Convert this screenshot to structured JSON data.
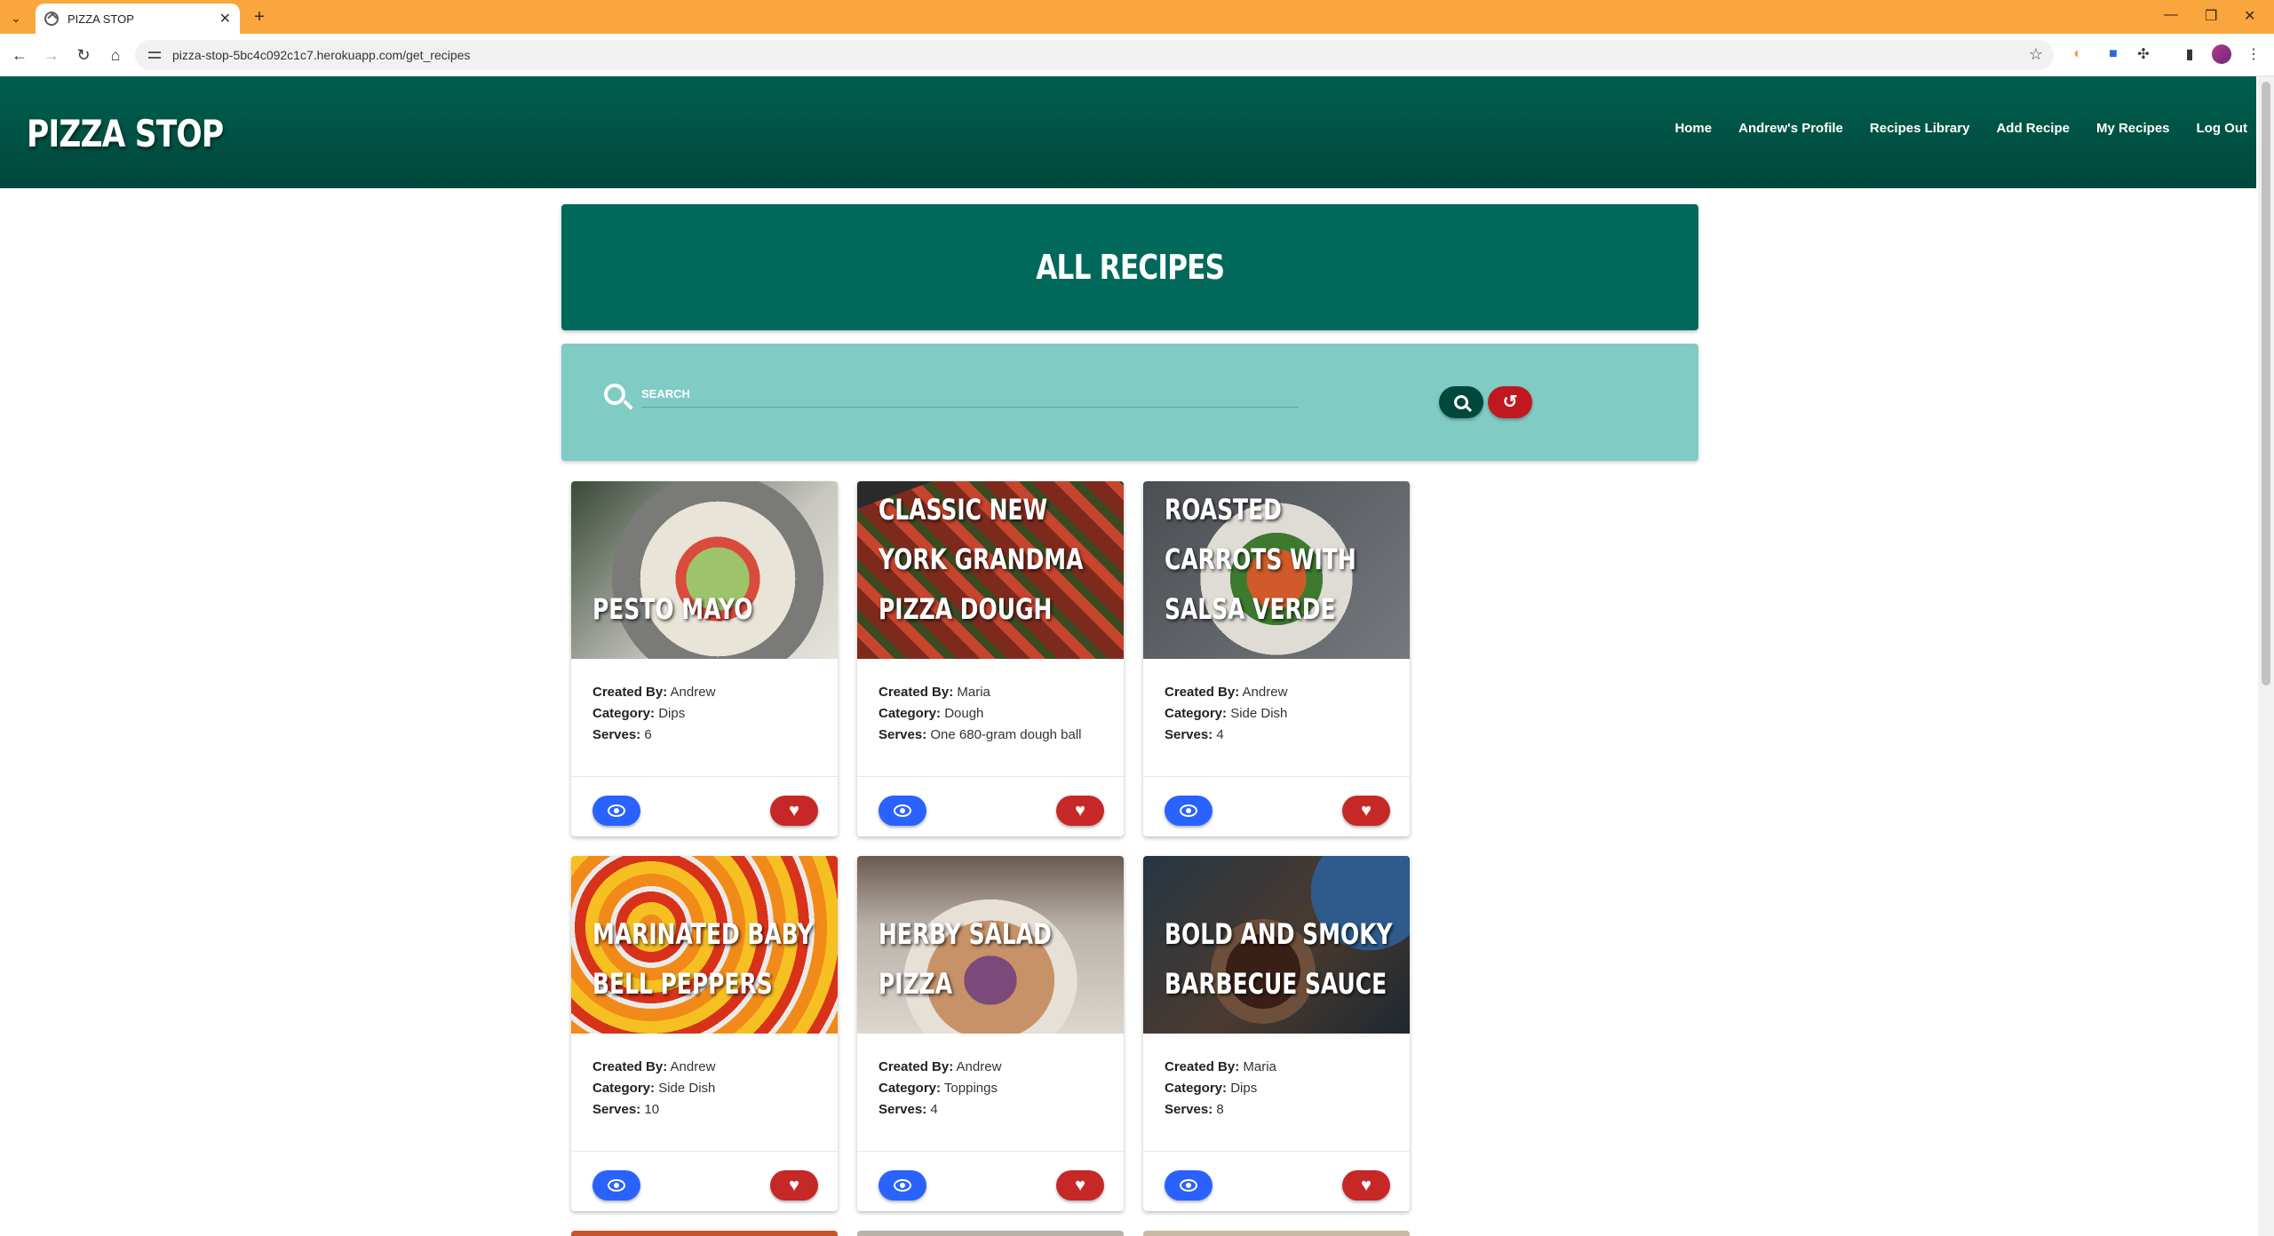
{
  "browser": {
    "tab_title": "PIZZA STOP",
    "url": "pizza-stop-5bc4c092c1c7.herokuapp.com/get_recipes"
  },
  "header": {
    "logo": "PIZZA STOP",
    "nav": [
      "Home",
      "Andrew's Profile",
      "Recipes Library",
      "Add Recipe",
      "My Recipes",
      "Log Out"
    ]
  },
  "page": {
    "title": "ALL RECIPES"
  },
  "search": {
    "placeholder": "SEARCH"
  },
  "labels": {
    "created_by": "Created By:",
    "category": "Category:",
    "serves": "Serves:"
  },
  "recipes": [
    {
      "title": "PESTO MAYO",
      "created_by": "Andrew",
      "category": "Dips",
      "serves": "6"
    },
    {
      "title": "CLASSIC NEW YORK GRANDMA PIZZA DOUGH",
      "created_by": "Maria",
      "category": "Dough",
      "serves": "One 680-gram dough ball"
    },
    {
      "title": "ROASTED CARROTS WITH SALSA VERDE",
      "created_by": "Andrew",
      "category": "Side Dish",
      "serves": "4"
    },
    {
      "title": "MARINATED BABY BELL PEPPERS",
      "created_by": "Andrew",
      "category": "Side Dish",
      "serves": "10"
    },
    {
      "title": "HERBY SALAD PIZZA",
      "created_by": "Andrew",
      "category": "Toppings",
      "serves": "4"
    },
    {
      "title": "BOLD AND SMOKY BARBECUE SAUCE",
      "created_by": "Maria",
      "category": "Dips",
      "serves": "8"
    }
  ],
  "colors": {
    "tabbar": "#f9a63e",
    "header": "#00604d",
    "banner": "#00695c",
    "search_panel": "#80cbc4",
    "view_button": "#2962ff",
    "favorite_button": "#c62828"
  }
}
